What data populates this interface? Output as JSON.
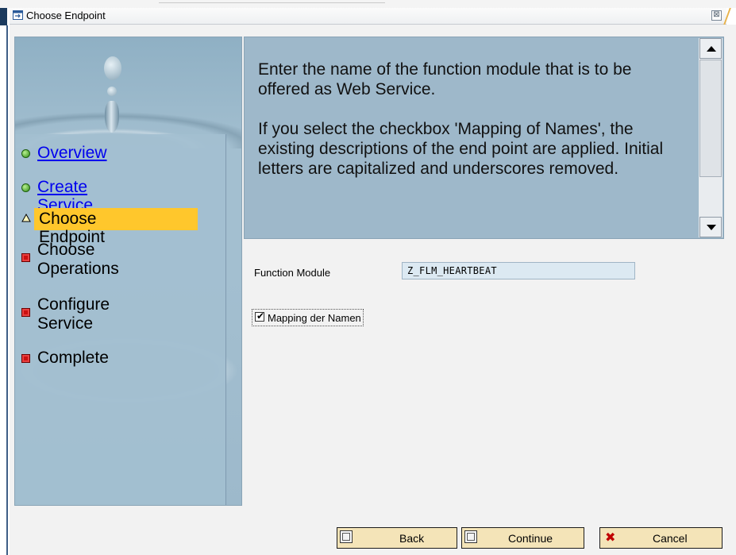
{
  "window": {
    "title": "Choose Endpoint",
    "close_glyph": "⊠"
  },
  "nav": {
    "steps": [
      {
        "label": "Overview",
        "state": "done",
        "link": true
      },
      {
        "label": "Create Service",
        "state": "done",
        "link": true
      },
      {
        "label": "Choose Endpoint",
        "state": "current",
        "link": false
      },
      {
        "label_lines": [
          "Choose",
          "Operations"
        ],
        "state": "pending",
        "link": false
      },
      {
        "label_lines": [
          "Configure",
          "Service"
        ],
        "state": "pending",
        "link": false
      },
      {
        "label": "Complete",
        "state": "pending",
        "link": false
      }
    ],
    "colors": {
      "done": "#2e8b16",
      "current": "#ffc72c",
      "pending": "#cc1010",
      "link": "#0000ee"
    }
  },
  "help": {
    "paragraphs": [
      "Enter the name of the function module that is to be offered as Web Service.",
      "If you select the checkbox 'Mapping of Names', the existing descriptions of the end point are applied. Initial letters are capitalized and underscores removed."
    ]
  },
  "form": {
    "function_module_label": "Function Module",
    "function_module_value": "Z_FLM_HEARTBEAT",
    "mapping_checkbox_label": "Mapping der Namen",
    "mapping_checked": true
  },
  "buttons": {
    "back": "Back",
    "continue": "Continue",
    "cancel": "Cancel"
  }
}
